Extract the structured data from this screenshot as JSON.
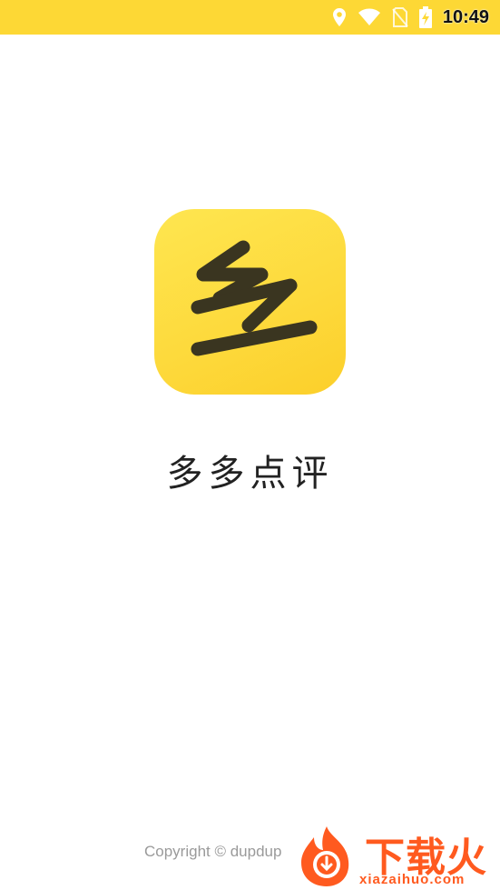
{
  "status_bar": {
    "time": "10:49",
    "icons": [
      "location-icon",
      "wifi-icon",
      "no-sim-icon",
      "battery-charging-icon"
    ],
    "background": "#fdd835"
  },
  "app": {
    "icon_glyph": "多",
    "name": "多多点评",
    "icon_color": "#fdd93b"
  },
  "footer": {
    "copyright": "Copyright © dupdup"
  },
  "watermark": {
    "brand": "下载火",
    "url": "xiazaihuo.com",
    "color": "#ff5a1f"
  }
}
